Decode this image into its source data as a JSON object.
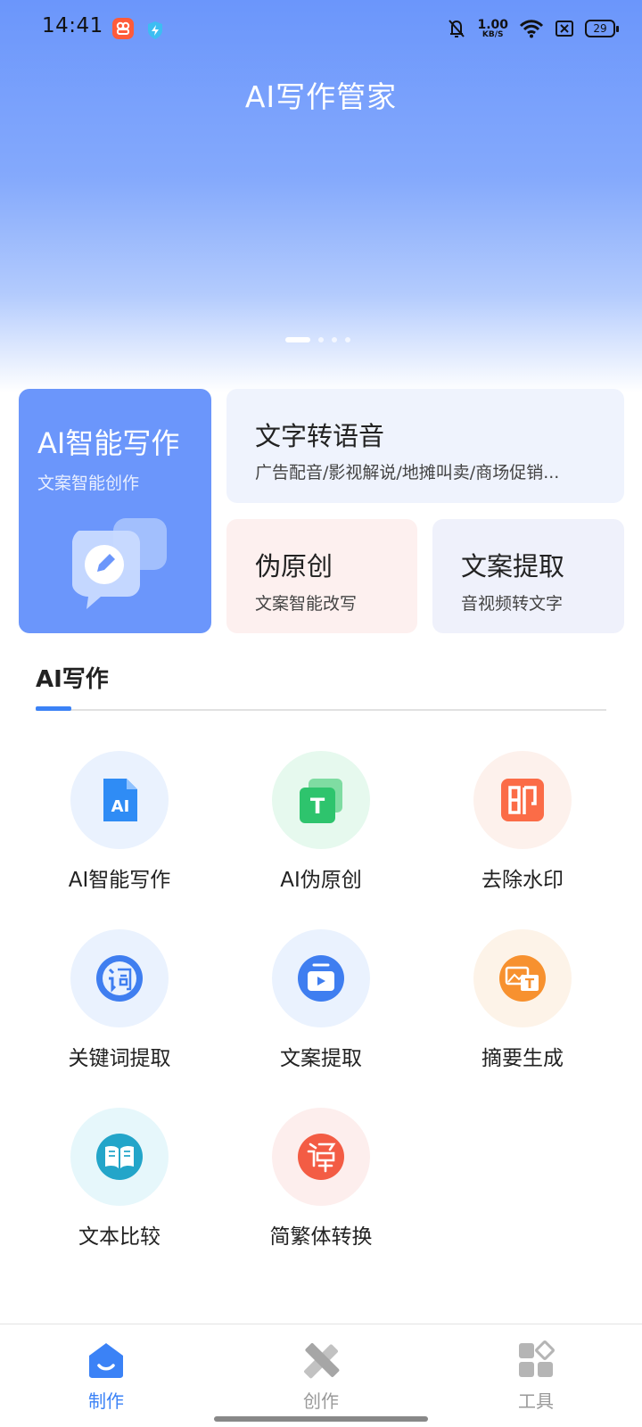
{
  "status_bar": {
    "time": "14:41",
    "net_speed_value": "1.00",
    "net_speed_unit": "KB/S",
    "battery": "29",
    "icons": [
      "app-badge-icon",
      "shield-bolt-icon",
      "bell-off-icon",
      "wifi-icon",
      "sim-off-icon",
      "battery-icon"
    ]
  },
  "header": {
    "title": "AI写作管家"
  },
  "carousel": {
    "page_count": 4,
    "active_index": 0
  },
  "feature_cards": {
    "ai_writing": {
      "title": "AI智能写作",
      "subtitle": "文案智能创作",
      "icon": "chat-edit-icon"
    },
    "tts": {
      "title": "文字转语音",
      "subtitle": "广告配音/影视解说/地摊叫卖/商场促销..."
    },
    "pseudo_original": {
      "title": "伪原创",
      "subtitle": "文案智能改写"
    },
    "copy_extract": {
      "title": "文案提取",
      "subtitle": "音视频转文字"
    }
  },
  "section": {
    "title": "AI写作"
  },
  "tools": [
    {
      "label": "AI智能写作",
      "icon": "ai-document-icon",
      "circle_color": "#eaf2fe",
      "icon_color": "#2f8cf5"
    },
    {
      "label": "AI伪原创",
      "icon": "t-copy-icon",
      "circle_color": "#e6f9ee",
      "icon_color": "#2ec46d"
    },
    {
      "label": "去除水印",
      "icon": "seal-stamp-icon",
      "circle_color": "#fdf1ec",
      "icon_color": "#fb6c47"
    },
    {
      "label": "关键词提取",
      "icon": "keyword-icon",
      "circle_color": "#eaf2fe",
      "icon_color": "#3f7ef0"
    },
    {
      "label": "文案提取",
      "icon": "video-extract-icon",
      "circle_color": "#eaf2fe",
      "icon_color": "#3f7ef0"
    },
    {
      "label": "摘要生成",
      "icon": "image-text-icon",
      "circle_color": "#fdf3e8",
      "icon_color": "#f7912f"
    },
    {
      "label": "文本比较",
      "icon": "book-compare-icon",
      "circle_color": "#e6f7fb",
      "icon_color": "#23a5c9"
    },
    {
      "label": "简繁体转换",
      "icon": "traditional-chinese-icon",
      "circle_color": "#fdeeed",
      "icon_color": "#f35c44"
    }
  ],
  "bottom_nav": {
    "items": [
      {
        "label": "制作",
        "icon": "home-icon",
        "active": true
      },
      {
        "label": "创作",
        "icon": "pencil-ruler-icon",
        "active": false
      },
      {
        "label": "工具",
        "icon": "grid-apps-icon",
        "active": false
      }
    ],
    "active_color": "#3b82f6",
    "inactive_color": "#9a9a9a"
  }
}
